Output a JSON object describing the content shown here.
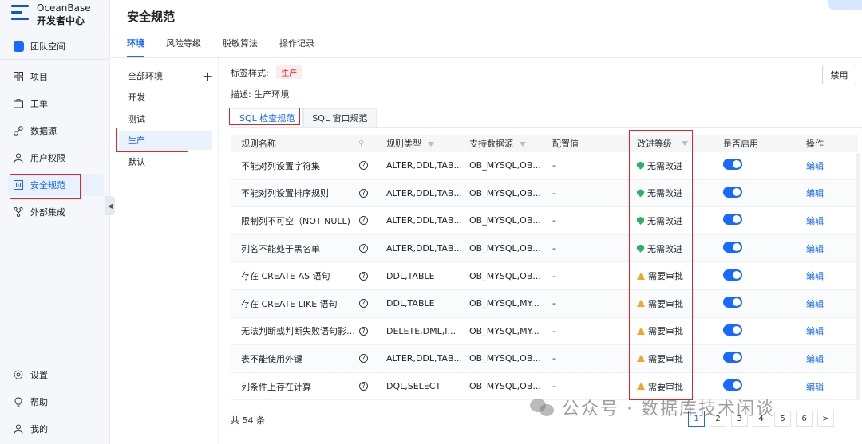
{
  "brand": {
    "line1": "OceanBase",
    "line2": "开发者中心"
  },
  "nav": {
    "team": "团队空间",
    "items": [
      {
        "label": "项目",
        "icon": "grid-icon"
      },
      {
        "label": "工单",
        "icon": "briefcase-icon"
      },
      {
        "label": "数据源",
        "icon": "link-icon"
      },
      {
        "label": "用户权限",
        "icon": "user-icon"
      },
      {
        "label": "安全规范",
        "icon": "security-rule-icon"
      },
      {
        "label": "外部集成",
        "icon": "integration-icon"
      }
    ],
    "bottom": [
      {
        "label": "设置",
        "icon": "gear-icon"
      },
      {
        "label": "帮助",
        "icon": "bulb-icon"
      },
      {
        "label": "我的",
        "icon": "user-icon"
      }
    ]
  },
  "page": {
    "title": "安全规范",
    "tabs": [
      "环境",
      "风险等级",
      "脱敏算法",
      "操作记录"
    ],
    "active_tab": "环境"
  },
  "environments": {
    "items": [
      "全部环境",
      "开发",
      "测试",
      "生产",
      "默认"
    ],
    "active": "生产",
    "add_icon": "plus-icon"
  },
  "detail": {
    "tag_style_label": "标签样式:",
    "tag_value": "生产",
    "desc_label": "描述:",
    "desc_value": "生产环境",
    "disable_button": "禁用",
    "subtabs": [
      "SQL 检查规范",
      "SQL 窗口规范"
    ],
    "active_subtab": "SQL 检查规范"
  },
  "table": {
    "headers": [
      "规则名称",
      "规则类型",
      "支持数据源",
      "配置值",
      "改进等级",
      "是否启用",
      "操作"
    ],
    "rows": [
      {
        "name": "不能对列设置字符集",
        "type": "ALTER,DDL,TAB...",
        "datasource": "OB_MYSQL,OB...",
        "config": "-",
        "level": "无需改进",
        "level_kind": "ok",
        "enabled": true,
        "action": "编辑"
      },
      {
        "name": "不能对列设置排序规则",
        "type": "ALTER,DDL,TAB...",
        "datasource": "OB_MYSQL,OB...",
        "config": "-",
        "level": "无需改进",
        "level_kind": "ok",
        "enabled": true,
        "action": "编辑"
      },
      {
        "name": "限制列不可空（NOT NULL)",
        "type": "ALTER,DDL,TAB...",
        "datasource": "OB_MYSQL,OB...",
        "config": "-",
        "level": "无需改进",
        "level_kind": "ok",
        "enabled": true,
        "action": "编辑"
      },
      {
        "name": "列名不能处于黑名单",
        "type": "ALTER,DDL,TAB...",
        "datasource": "OB_MYSQL,OB...",
        "config": "-",
        "level": "无需改进",
        "level_kind": "ok",
        "enabled": true,
        "action": "编辑"
      },
      {
        "name": "存在 CREATE AS 语句",
        "type": "DDL,TABLE",
        "datasource": "OB_MYSQL,OB...",
        "config": "-",
        "level": "需要审批",
        "level_kind": "warn",
        "enabled": true,
        "action": "编辑"
      },
      {
        "name": "存在 CREATE LIKE 语句",
        "type": "DDL,TABLE",
        "datasource": "OB_MYSQL,MY...",
        "config": "-",
        "level": "需要审批",
        "level_kind": "warn",
        "enabled": true,
        "action": "编辑"
      },
      {
        "name": "无法判断或判断失败语句影响...",
        "type": "DELETE,DML,I...",
        "datasource": "OB_MYSQL,MY...",
        "config": "-",
        "level": "需要审批",
        "level_kind": "warn",
        "enabled": true,
        "action": "编辑"
      },
      {
        "name": "表不能使用外键",
        "type": "ALTER,DDL,TAB...",
        "datasource": "OB_MYSQL,OB...",
        "config": "-",
        "level": "需要审批",
        "level_kind": "warn",
        "enabled": true,
        "action": "编辑"
      },
      {
        "name": "列条件上存在计算",
        "type": "DQL,SELECT",
        "datasource": "OB_MYSQL,OB...",
        "config": "-",
        "level": "需要审批",
        "level_kind": "warn",
        "enabled": true,
        "action": "编辑"
      }
    ]
  },
  "footer": {
    "total": "共 54 条",
    "pages": [
      "1",
      "2",
      "3",
      "4",
      "5",
      "6"
    ],
    "active_page": "1",
    "next": ">"
  },
  "watermark": "公众号 · 数据库技术闲谈",
  "colors": {
    "accent": "#1769ff",
    "highlight_box": "#e0242a",
    "ok": "#29b560",
    "warn": "#f5a623"
  }
}
